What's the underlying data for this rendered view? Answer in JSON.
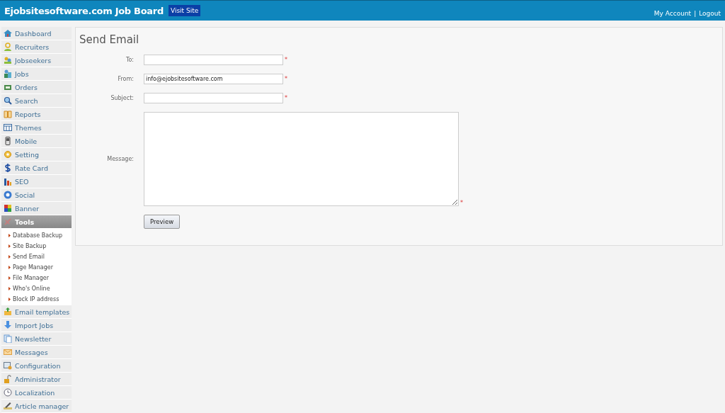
{
  "header": {
    "title": "Ejobsitesoftware.com Job Board",
    "visit_button": "Visit Site",
    "links": [
      "My Account",
      "Logout"
    ],
    "separator": "|"
  },
  "sidebar": {
    "items": [
      {
        "label": "Dashboard",
        "selected": false
      },
      {
        "label": "Recruiters",
        "selected": false
      },
      {
        "label": "Jobseekers",
        "selected": false
      },
      {
        "label": "Jobs",
        "selected": false
      },
      {
        "label": "Orders",
        "selected": false
      },
      {
        "label": "Search",
        "selected": false
      },
      {
        "label": "Reports",
        "selected": false
      },
      {
        "label": "Themes",
        "selected": false
      },
      {
        "label": "Mobile",
        "selected": false
      },
      {
        "label": "Setting",
        "selected": false
      },
      {
        "label": "Rate Card",
        "selected": false
      },
      {
        "label": "SEO",
        "selected": false
      },
      {
        "label": "Social",
        "selected": false
      },
      {
        "label": "Banner",
        "selected": false
      },
      {
        "label": "Tools",
        "selected": true,
        "children": [
          "Database Backup",
          "Site Backup",
          "Send Email",
          "Page Manager",
          "File Manager",
          "Who's Online",
          "Block IP address"
        ]
      },
      {
        "label": "Email templates",
        "selected": false
      },
      {
        "label": "Import Jobs",
        "selected": false
      },
      {
        "label": "Newsletter",
        "selected": false
      },
      {
        "label": "Messages",
        "selected": false
      },
      {
        "label": "Configuration",
        "selected": false
      },
      {
        "label": "Administrator",
        "selected": false
      },
      {
        "label": "Localization",
        "selected": false
      },
      {
        "label": "Article manager",
        "selected": false
      }
    ]
  },
  "form": {
    "title": "Send Email",
    "fields": [
      {
        "label": "To:",
        "kind": "text",
        "mark": "*"
      },
      {
        "label": "From:",
        "kind": "text",
        "value": "info@ejobsitesoftware.com",
        "mark": "*"
      },
      {
        "label": "Subject:",
        "kind": "text",
        "mark": "*"
      },
      {
        "label": "Message:",
        "kind": "textarea",
        "mark": "*"
      }
    ],
    "button": "Preview"
  }
}
